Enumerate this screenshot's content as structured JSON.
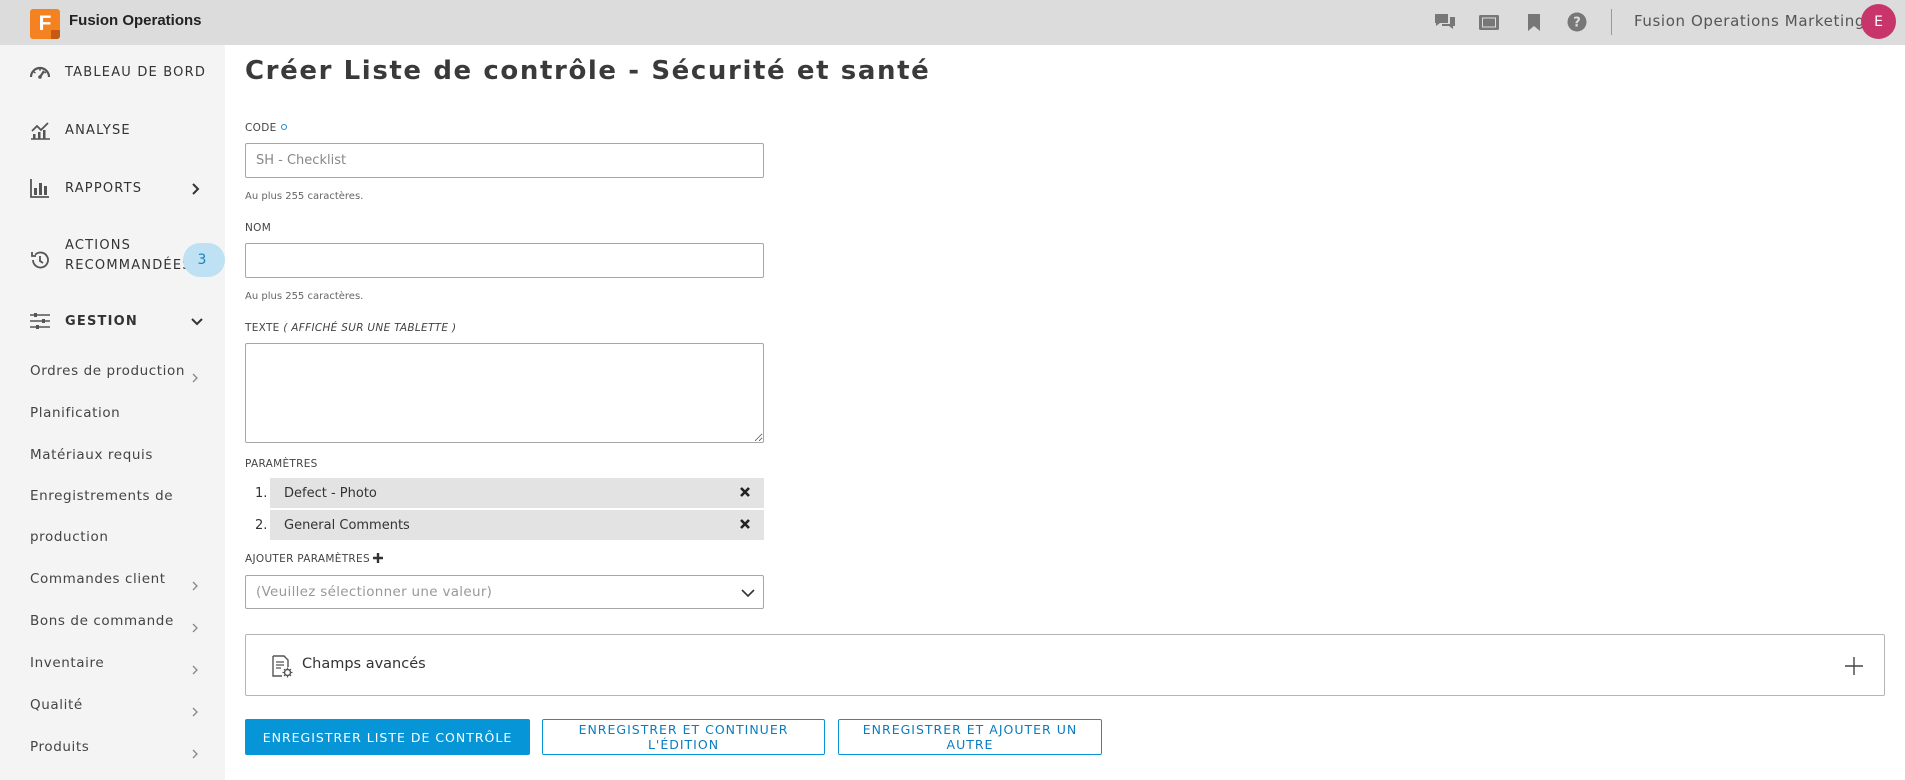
{
  "app": {
    "logo_letter": "F",
    "title": "Fusion Operations"
  },
  "topbar": {
    "icons": [
      "chat-icon",
      "tablet-icon",
      "bookmark-icon",
      "help-icon"
    ],
    "account_name": "Fusion Operations Marketing",
    "avatar_initial": "E"
  },
  "sidebar": {
    "dashboard": "TABLEAU DE BORD",
    "analysis": "ANALYSE",
    "reports": "RAPPORTS",
    "actions_line1": "ACTIONS",
    "actions_line2": "RECOMMANDÉES",
    "actions_badge": "3",
    "management": "GESTION",
    "sub_items": {
      "production_orders": "Ordres de production",
      "planning": "Planification",
      "required_materials": "Matériaux requis",
      "production_records_line1": "Enregistrements de",
      "production_records_line2": "production",
      "customer_orders": "Commandes client",
      "purchase_orders": "Bons de commande",
      "inventory": "Inventaire",
      "quality": "Qualité",
      "products": "Produits"
    }
  },
  "page": {
    "title": "Créer Liste de contrôle - Sécurité et santé",
    "code_label": "CODE",
    "code_placeholder": "SH - Checklist",
    "code_hint": "Au plus 255 caractères.",
    "name_label": "NOM",
    "name_value": "",
    "name_hint": "Au plus 255 caractères.",
    "text_label": "TEXTE",
    "text_label_note": "( AFFICHÉ SUR UNE TABLETTE )",
    "params_label": "PARAMÈTRES",
    "params": [
      {
        "num": "1.",
        "name": "Defect - Photo"
      },
      {
        "num": "2.",
        "name": "General Comments"
      }
    ],
    "add_params_label": "AJOUTER PARAMÈTRES",
    "add_params_placeholder": "(Veuillez sélectionner une valeur)",
    "advanced_label": "Champs avancés",
    "buttons": {
      "save": "ENREGISTRER LISTE DE CONTRÔLE",
      "save_continue": "ENREGISTRER ET CONTINUER L'ÉDITION",
      "save_add": "ENREGISTRER ET AJOUTER UN AUTRE"
    }
  },
  "colors": {
    "accent": "#0696d7",
    "brand_orange": "#f58220",
    "avatar": "#c8356b",
    "badge_bg": "#bfe1f4"
  }
}
